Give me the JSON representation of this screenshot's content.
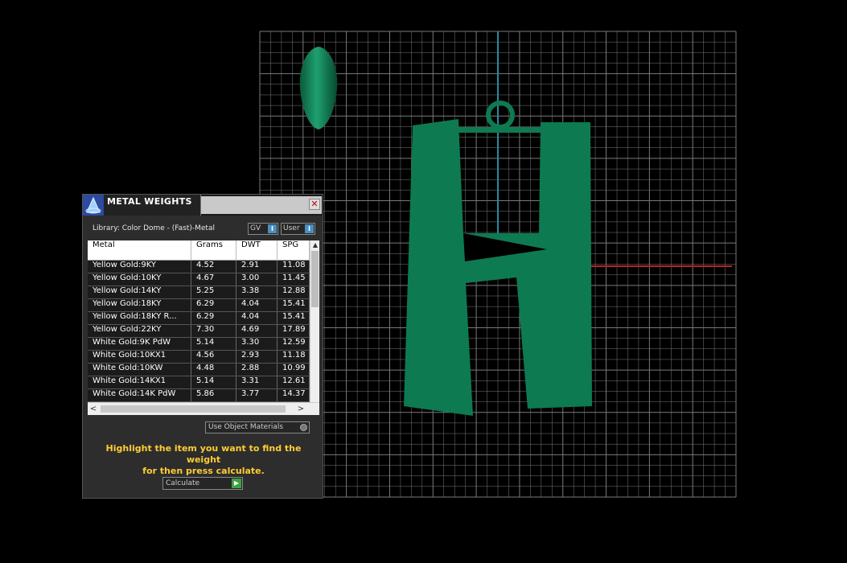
{
  "panel": {
    "title": "METAL WEIGHTS",
    "close_glyph": "✕",
    "library_label": "Library: Color Dome - (Fast)-Metal",
    "gv_toggle": "GV",
    "user_toggle": "User",
    "toggle_knob": "I",
    "columns": [
      "Metal",
      "Grams",
      "DWT",
      "SPG"
    ],
    "rows": [
      [
        "Yellow Gold:9KY",
        "4.52",
        "2.91",
        "11.08"
      ],
      [
        "Yellow Gold:10KY",
        "4.67",
        "3.00",
        "11.45"
      ],
      [
        "Yellow Gold:14KY",
        "5.25",
        "3.38",
        "12.88"
      ],
      [
        "Yellow Gold:18KY",
        "6.29",
        "4.04",
        "15.41"
      ],
      [
        "Yellow Gold:18KY R...",
        "6.29",
        "4.04",
        "15.41"
      ],
      [
        "Yellow Gold:22KY",
        "7.30",
        "4.69",
        "17.89"
      ],
      [
        "White Gold:9K PdW",
        "5.14",
        "3.30",
        "12.59"
      ],
      [
        "White Gold:10KX1",
        "4.56",
        "2.93",
        "11.18"
      ],
      [
        "White Gold:10KW",
        "4.48",
        "2.88",
        "10.99"
      ],
      [
        "White Gold:14KX1",
        "5.14",
        "3.31",
        "12.61"
      ],
      [
        "White Gold:14K PdW",
        "5.86",
        "3.77",
        "14.37"
      ]
    ],
    "scroll_up": "▲",
    "scroll_left": "<",
    "scroll_right": ">",
    "use_object_materials": "Use Object Materials",
    "instructions_line1": "Highlight the item you want to find the weight",
    "instructions_line2": "for then press calculate.",
    "calculate_label": "Calculate",
    "calculate_glyph": "▶"
  },
  "viewport": {
    "model_color": "#0e7a52",
    "grid_color": "#7a7a7a",
    "y_axis_color": "#2a8a9a",
    "x_axis_color": "#c02020"
  },
  "icons": [
    "app-logo-icon",
    "close-icon",
    "teardrop-gem-icon",
    "letter-h-pendant-icon"
  ]
}
